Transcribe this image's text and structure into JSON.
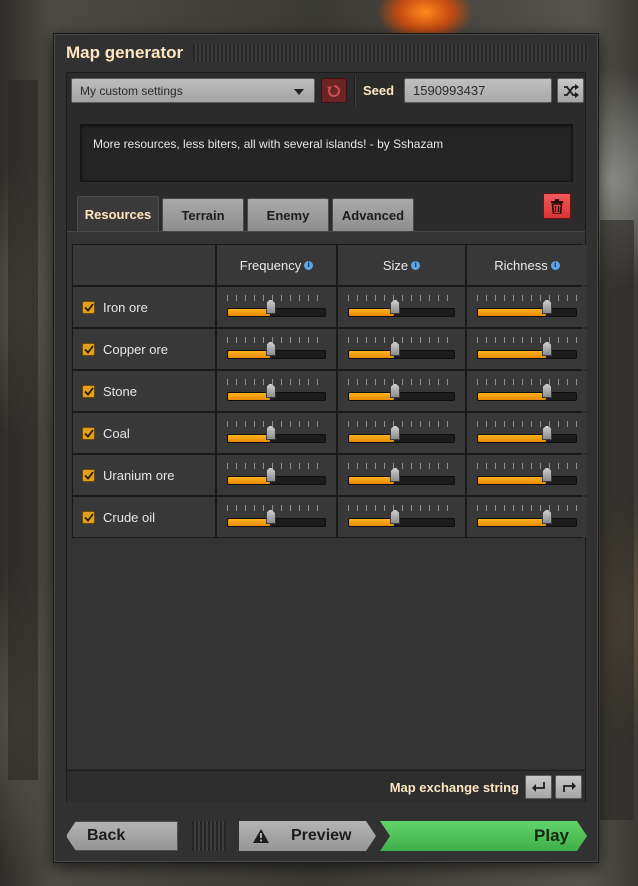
{
  "window": {
    "title": "Map generator"
  },
  "top": {
    "preset": "My custom settings",
    "seed_label": "Seed",
    "seed_value": "1590993437"
  },
  "description": "More resources, less biters, all with several islands! - by Sshazam",
  "tabs": [
    {
      "label": "Resources",
      "active": true
    },
    {
      "label": "Terrain",
      "active": false
    },
    {
      "label": "Enemy",
      "active": false
    },
    {
      "label": "Advanced",
      "active": false
    }
  ],
  "table": {
    "columns": [
      "Frequency",
      "Size",
      "Richness"
    ],
    "info_glyph": "i",
    "rows": [
      {
        "name": "Iron ore",
        "checked": true,
        "frequency": 0.44,
        "size": 0.44,
        "richness": 0.7
      },
      {
        "name": "Copper ore",
        "checked": true,
        "frequency": 0.44,
        "size": 0.44,
        "richness": 0.7
      },
      {
        "name": "Stone",
        "checked": true,
        "frequency": 0.44,
        "size": 0.44,
        "richness": 0.7
      },
      {
        "name": "Coal",
        "checked": true,
        "frequency": 0.44,
        "size": 0.44,
        "richness": 0.7
      },
      {
        "name": "Uranium ore",
        "checked": true,
        "frequency": 0.44,
        "size": 0.44,
        "richness": 0.7
      },
      {
        "name": "Crude oil",
        "checked": true,
        "frequency": 0.44,
        "size": 0.44,
        "richness": 0.7
      }
    ]
  },
  "footer": {
    "exchange_label": "Map exchange string"
  },
  "buttons": {
    "back": "Back",
    "preview": "Preview",
    "play": "Play"
  },
  "colors": {
    "accent_orange": "#f0a010",
    "play_green": "#4cc054",
    "delete_red": "#e44040",
    "header_text": "#ffe6c0"
  },
  "icons": {
    "reset": "reset-icon",
    "shuffle": "shuffle-icon",
    "delete": "trash-icon",
    "import": "import-icon",
    "export": "export-icon",
    "warning": "warning-icon"
  }
}
